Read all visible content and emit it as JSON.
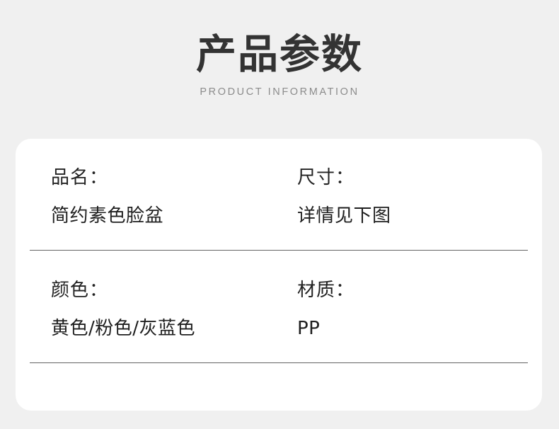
{
  "header": {
    "title": "产品参数",
    "subtitle": "PRODUCT INFORMATION"
  },
  "card": {
    "rows": [
      {
        "left": {
          "label": "品名：",
          "value": "简约素色脸盆"
        },
        "right": {
          "label": "尺寸：",
          "value": "详情见下图"
        }
      },
      {
        "left": {
          "label": "颜色：",
          "value": "黄色/粉色/灰蓝色"
        },
        "right": {
          "label": "材质：",
          "value": "PP"
        }
      }
    ]
  },
  "colors": {
    "page_background": "#f0f0f0",
    "card_background": "#ffffff",
    "title_text": "#333333",
    "subtitle_text": "#8c8c8c",
    "label_text": "#222222",
    "value_text": "#1f1f1f",
    "divider": "#646464"
  }
}
